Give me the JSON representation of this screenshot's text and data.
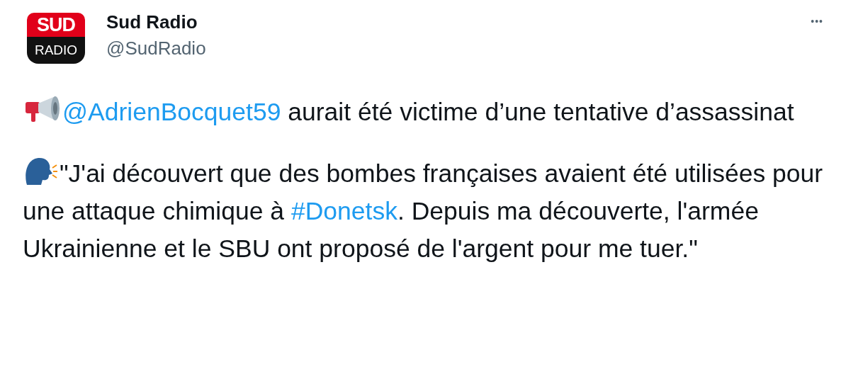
{
  "account": {
    "logo": {
      "top": "SUD",
      "bottom": "RADIO"
    },
    "name": "Sud Radio",
    "handle": "@SudRadio",
    "menu": "•••"
  },
  "tweet": {
    "paragraphs": [
      [
        {
          "kind": "mention",
          "text": "@AdrienBocquet59"
        },
        {
          "kind": "text",
          "text": " aurait été victime d’une tentative d’assassinat"
        }
      ],
      [
        {
          "kind": "text",
          "text": "\"J'ai découvert que des bombes françaises avaient été utilisées pour une attaque chimique à "
        },
        {
          "kind": "hashtag",
          "text": "#Donetsk"
        },
        {
          "kind": "text",
          "text": ". Depuis ma découverte, l'armée Ukrainienne et le SBU ont proposé de l'argent pour me tuer.\""
        }
      ]
    ]
  }
}
